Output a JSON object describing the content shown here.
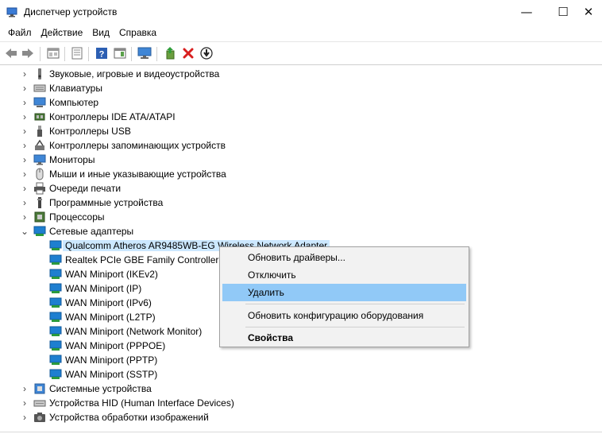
{
  "window": {
    "title": "Диспетчер устройств",
    "icon": "device-manager-icon",
    "controls": {
      "minimize": "—",
      "maximize": "☐",
      "close": "✕"
    }
  },
  "menu": [
    "Файл",
    "Действие",
    "Вид",
    "Справка"
  ],
  "toolbar": [
    {
      "icon": "back-arrow-icon"
    },
    {
      "icon": "forward-arrow-icon"
    },
    {
      "icon": "properties-sheet-icon"
    },
    {
      "icon": "show-hidden-icon"
    },
    {
      "icon": "help-icon"
    },
    {
      "icon": "action-pane-icon"
    },
    {
      "icon": "monitor-scan-icon"
    },
    {
      "icon": "update-driver-icon"
    },
    {
      "icon": "delete-icon"
    },
    {
      "icon": "enable-device-icon"
    }
  ],
  "tree": {
    "categories_top": [
      {
        "label": "Звуковые, игровые и видеоустройства",
        "icon": "speaker-icon"
      },
      {
        "label": "Клавиатуры",
        "icon": "keyboard-icon"
      },
      {
        "label": "Компьютер",
        "icon": "computer-icon"
      },
      {
        "label": "Контроллеры IDE ATA/ATAPI",
        "icon": "ide-controller-icon"
      },
      {
        "label": "Контроллеры USB",
        "icon": "usb-icon"
      },
      {
        "label": "Контроллеры запоминающих устройств",
        "icon": "storage-controller-icon"
      },
      {
        "label": "Мониторы",
        "icon": "monitor-icon"
      },
      {
        "label": "Мыши и иные указывающие устройства",
        "icon": "mouse-icon"
      },
      {
        "label": "Очереди печати",
        "icon": "printer-icon"
      },
      {
        "label": "Программные устройства",
        "icon": "software-device-icon"
      },
      {
        "label": "Процессоры",
        "icon": "processor-icon"
      },
      {
        "label": "Сетевые адаптеры",
        "icon": "network-adapter-icon",
        "expanded": true
      }
    ],
    "network_children": [
      {
        "label": "Qualcomm Atheros AR9485WB-EG Wireless Network Adapter",
        "selected": true
      },
      {
        "label": "Realtek PCIe GBE Family Controller"
      },
      {
        "label": "WAN Miniport (IKEv2)"
      },
      {
        "label": "WAN Miniport (IP)"
      },
      {
        "label": "WAN Miniport (IPv6)"
      },
      {
        "label": "WAN Miniport (L2TP)"
      },
      {
        "label": "WAN Miniport (Network Monitor)"
      },
      {
        "label": "WAN Miniport (PPPOE)"
      },
      {
        "label": "WAN Miniport (PPTP)"
      },
      {
        "label": "WAN Miniport (SSTP)"
      }
    ],
    "categories_bottom": [
      {
        "label": "Системные устройства",
        "icon": "system-device-icon"
      },
      {
        "label": "Устройства HID (Human Interface Devices)",
        "icon": "hid-icon"
      },
      {
        "label": "Устройства обработки изображений",
        "icon": "camera-icon"
      }
    ]
  },
  "context_menu": {
    "items": [
      {
        "label": "Обновить драйверы..."
      },
      {
        "label": "Отключить"
      },
      {
        "label": "Удалить",
        "highlighted": true
      },
      {
        "label": "Обновить конфигурацию оборудования"
      },
      {
        "label": "Свойства",
        "bold": true
      }
    ]
  },
  "colors": {
    "selection": "#cce8ff",
    "menu_highlight": "#91c9f7",
    "delete_red": "#d81e1e",
    "adapter_blue": "#1e7fd0"
  }
}
